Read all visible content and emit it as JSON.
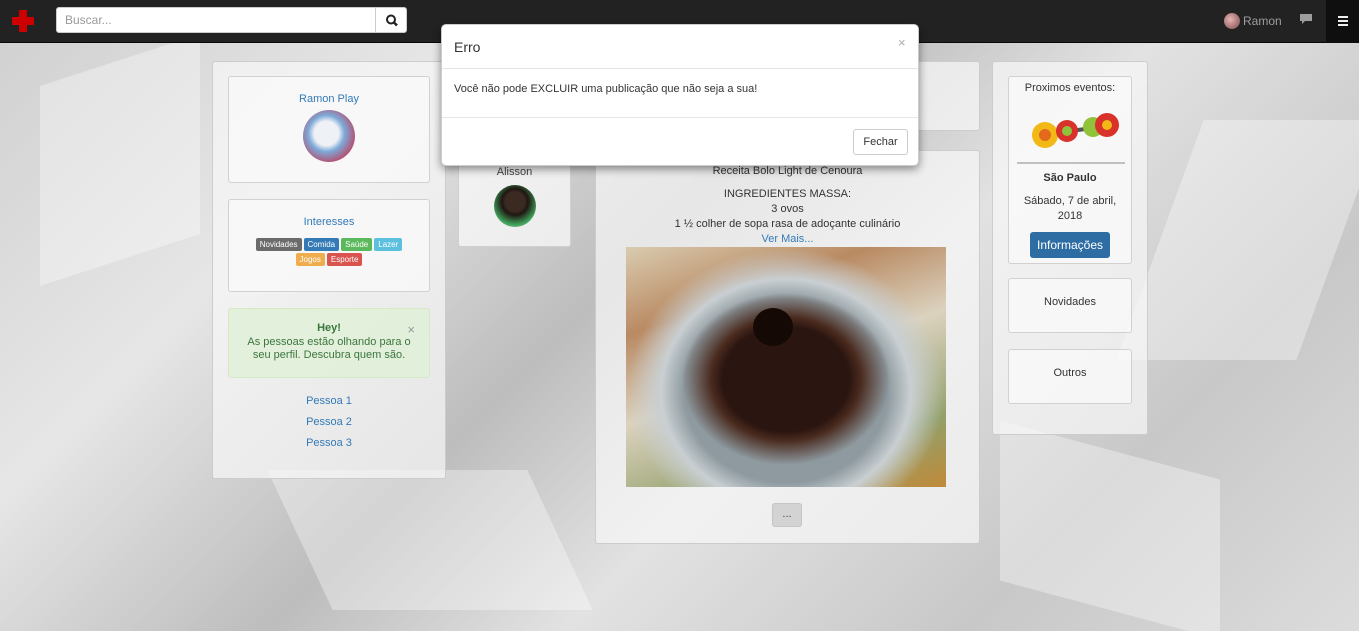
{
  "navbar": {
    "search_placeholder": "Buscar...",
    "user_name": "Ramon"
  },
  "profile": {
    "name": "Ramon Play"
  },
  "interests": {
    "title": "Interesses",
    "tags": [
      {
        "label": "Novidades",
        "color": "#6b6b6b"
      },
      {
        "label": "Comida",
        "color": "#337ab7"
      },
      {
        "label": "Saúde",
        "color": "#5cb85c"
      },
      {
        "label": "Lazer",
        "color": "#5bc0de"
      },
      {
        "label": "Jogos",
        "color": "#f0ad4e"
      },
      {
        "label": "Esporte",
        "color": "#d9534f"
      }
    ]
  },
  "alert": {
    "title": "Hey!",
    "line1": "As pessoas estão olhando para o",
    "line2": "seu perfil. Descubra quem são.",
    "close": "×"
  },
  "people": [
    "Pessoa 1",
    "Pessoa 2",
    "Pessoa 3"
  ],
  "post": {
    "author": "Alisson",
    "title": "Receita Bolo Light de Cenoura",
    "line1": "INGREDIENTES MASSA:",
    "line2": "3 ovos",
    "line3": "1 ½ colher de sopa rasa de adoçante culinário",
    "see_more": "Ver Mais...",
    "more_button": "..."
  },
  "events": {
    "title": "Proximos eventos:",
    "city": "São Paulo",
    "date_line1": "Sábado, 7 de abril,",
    "date_line2": "2018",
    "info_button": "Informações",
    "card2": "Novidades",
    "card3": "Outros"
  },
  "modal": {
    "title": "Erro",
    "close_symbol": "×",
    "message": "Você não pode EXCLUIR uma publicação que não seja a sua!",
    "close_button": "Fechar"
  }
}
